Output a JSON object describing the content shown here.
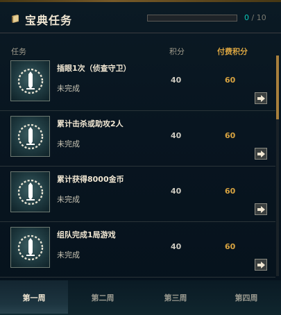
{
  "header": {
    "title": "宝典任务",
    "progress_current": "0",
    "progress_sep": " / ",
    "progress_total": "10",
    "progress_fraction": 0
  },
  "columns": {
    "task": "任务",
    "points": "积分",
    "paid_points": "付费积分"
  },
  "tasks": [
    {
      "name": "插眼1次（侦查守卫）",
      "status": "未完成",
      "points": "40",
      "paid": "60",
      "icon": "ward-emblem-icon"
    },
    {
      "name": "累计击杀或助攻2人",
      "status": "未完成",
      "points": "40",
      "paid": "60",
      "icon": "ward-emblem-icon"
    },
    {
      "name": "累计获得8000金币",
      "status": "未完成",
      "points": "40",
      "paid": "60",
      "icon": "ward-emblem-icon"
    },
    {
      "name": "组队完成1局游戏",
      "status": "未完成",
      "points": "40",
      "paid": "60",
      "icon": "ward-emblem-icon"
    }
  ],
  "tabs": [
    {
      "label": "第一周",
      "active": true
    },
    {
      "label": "第二周",
      "active": false
    },
    {
      "label": "第三周",
      "active": false
    },
    {
      "label": "第四周",
      "active": false
    }
  ],
  "colors": {
    "accent_teal": "#0ac8b9",
    "gold": "#d9a441",
    "text_light": "#f0e6d2"
  }
}
